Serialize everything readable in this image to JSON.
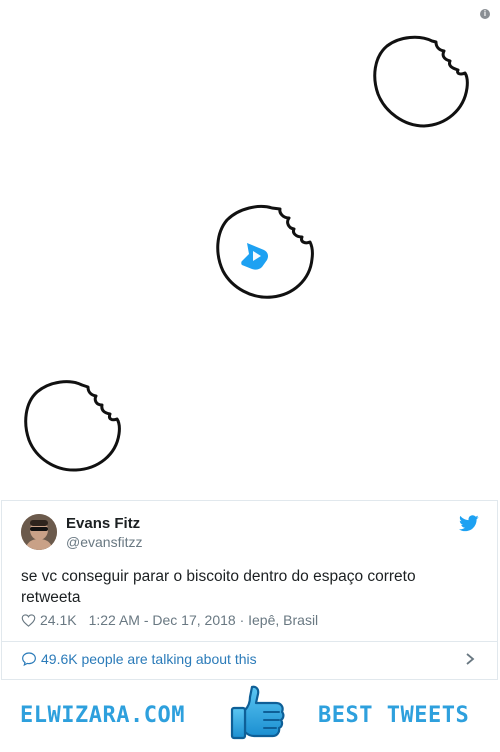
{
  "media": {
    "info_icon": "info-icon",
    "cookies": [
      "cookie-icon",
      "cookie-icon",
      "cookie-icon"
    ],
    "play_icon": "play-icon"
  },
  "tweet": {
    "author_name": "Evans Fitz",
    "author_handle": "@evansfitzz",
    "text": "se vc conseguir parar o biscoito dentro do espaço correto retweeta",
    "likes": "24.1K",
    "timestamp": "1:22 AM - Dec 17, 2018 · Iepê, Brasil",
    "talking": "49.6K people are talking about this",
    "icons": {
      "bird": "twitter-bird-icon",
      "heart": "heart-icon",
      "bubble": "speech-bubble-icon",
      "chevron": "chevron-right-icon"
    }
  },
  "footer": {
    "left_brand": "ELWIZARA.COM",
    "right_brand": "BEST TWEETS",
    "icon": "thumbs-up-icon"
  },
  "colors": {
    "link": "#2b7bb9",
    "brand": "#2ea0dd",
    "text": "#1c2022",
    "muted": "#697882"
  }
}
